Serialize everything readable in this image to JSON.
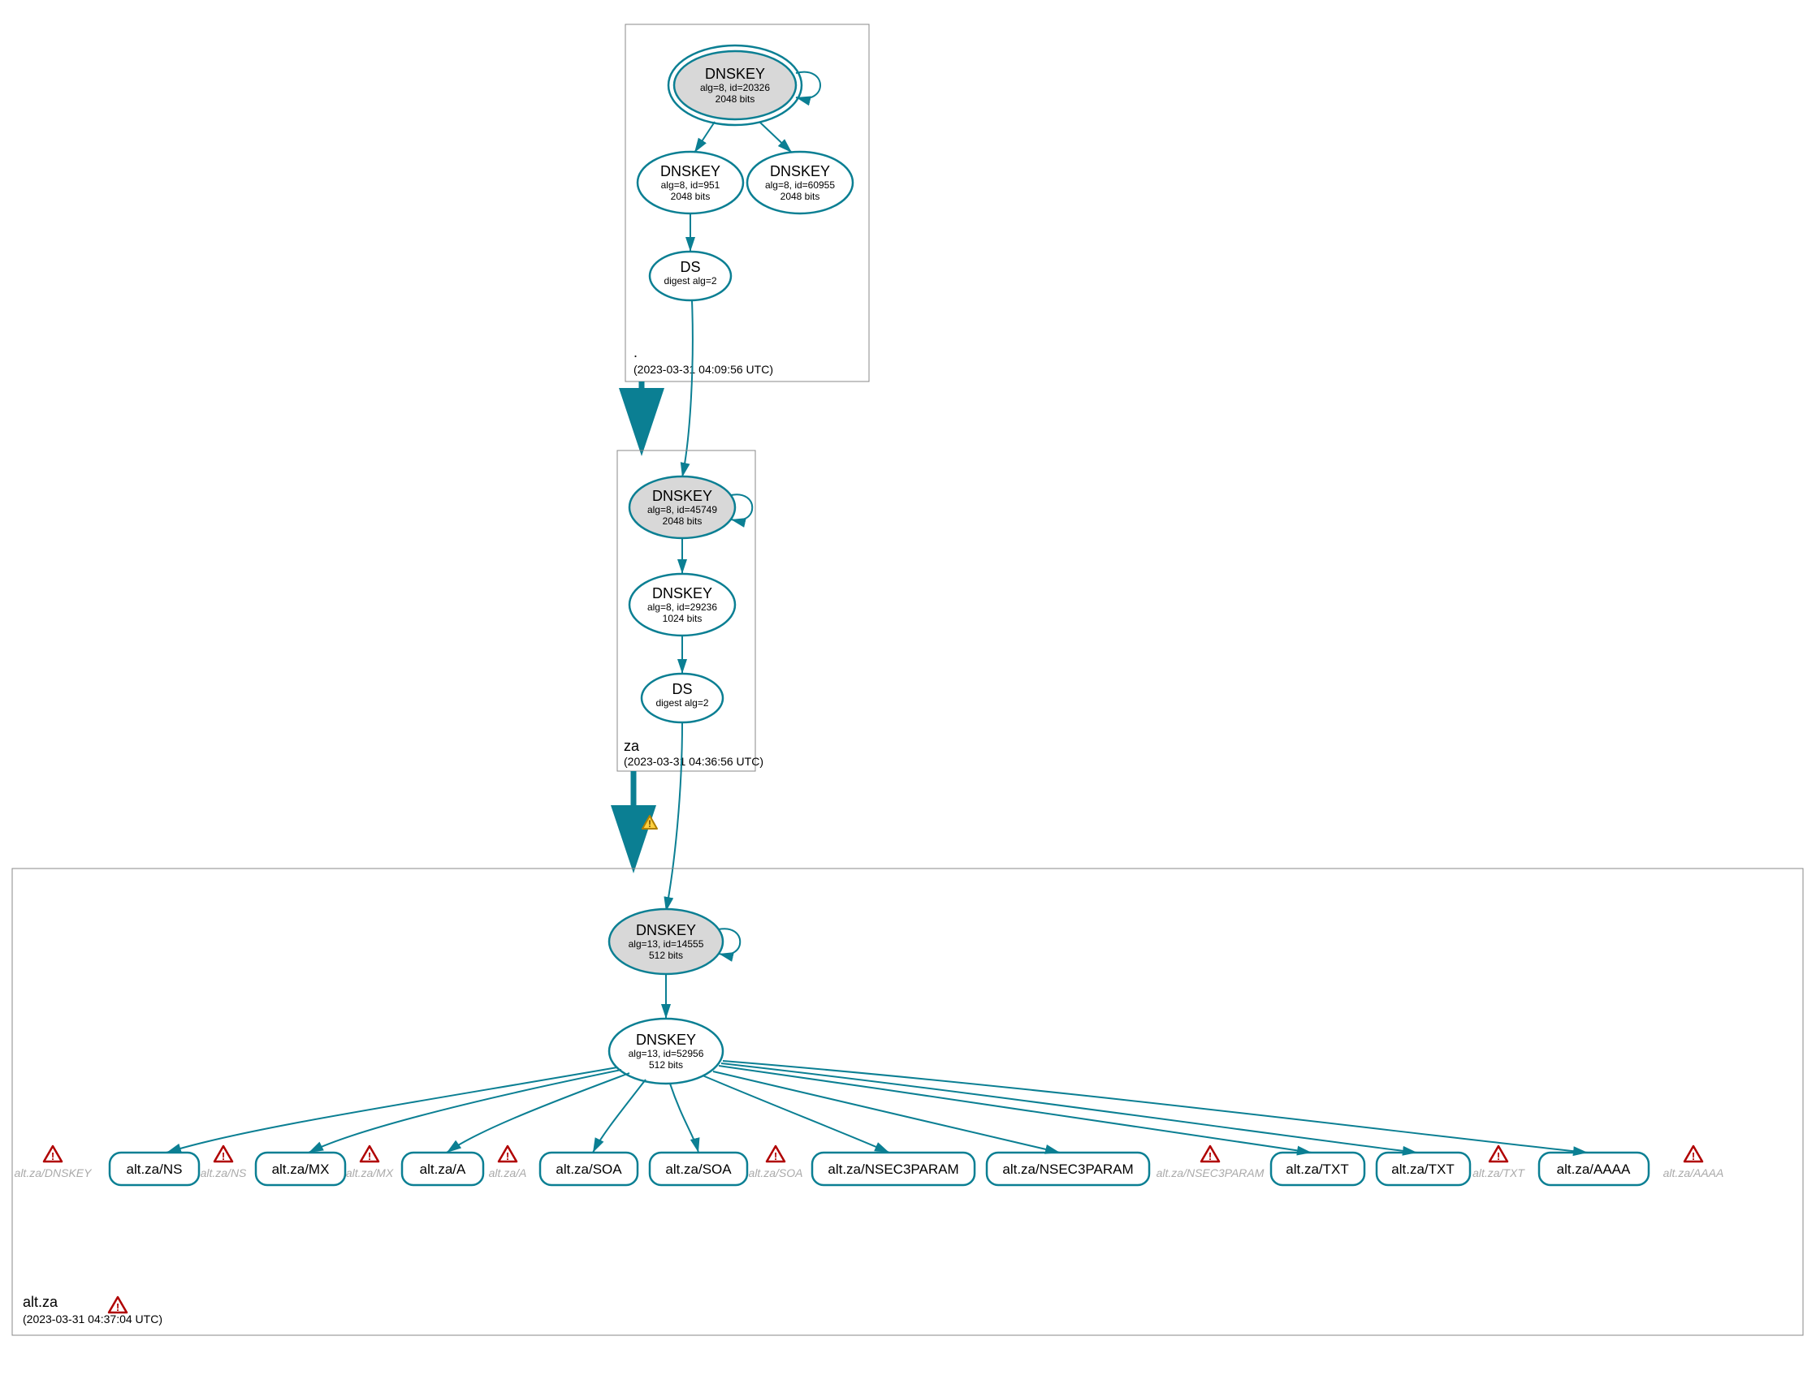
{
  "zones": {
    "root": {
      "label": ".",
      "timestamp": "(2023-03-31 04:09:56 UTC)"
    },
    "za": {
      "label": "za",
      "timestamp": "(2023-03-31 04:36:56 UTC)"
    },
    "alt": {
      "label": "alt.za",
      "timestamp": "(2023-03-31 04:37:04 UTC)"
    }
  },
  "nodes": {
    "root_ksk": {
      "title": "DNSKEY",
      "line1": "alg=8, id=20326",
      "line2": "2048 bits"
    },
    "root_zsk1": {
      "title": "DNSKEY",
      "line1": "alg=8, id=951",
      "line2": "2048 bits"
    },
    "root_zsk2": {
      "title": "DNSKEY",
      "line1": "alg=8, id=60955",
      "line2": "2048 bits"
    },
    "root_ds": {
      "title": "DS",
      "line1": "digest alg=2",
      "line2": ""
    },
    "za_ksk": {
      "title": "DNSKEY",
      "line1": "alg=8, id=45749",
      "line2": "2048 bits"
    },
    "za_zsk": {
      "title": "DNSKEY",
      "line1": "alg=8, id=29236",
      "line2": "1024 bits"
    },
    "za_ds": {
      "title": "DS",
      "line1": "digest alg=2",
      "line2": ""
    },
    "alt_ksk": {
      "title": "DNSKEY",
      "line1": "alg=13, id=14555",
      "line2": "512 bits"
    },
    "alt_zsk": {
      "title": "DNSKEY",
      "line1": "alg=13, id=52956",
      "line2": "512 bits"
    }
  },
  "rrsets": [
    {
      "id": "ns",
      "label": "alt.za/NS"
    },
    {
      "id": "mx",
      "label": "alt.za/MX"
    },
    {
      "id": "a",
      "label": "alt.za/A"
    },
    {
      "id": "soa1",
      "label": "alt.za/SOA"
    },
    {
      "id": "soa2",
      "label": "alt.za/SOA"
    },
    {
      "id": "n3p1",
      "label": "alt.za/NSEC3PARAM"
    },
    {
      "id": "n3p2",
      "label": "alt.za/NSEC3PARAM"
    },
    {
      "id": "txt1",
      "label": "alt.za/TXT"
    },
    {
      "id": "txt2",
      "label": "alt.za/TXT"
    },
    {
      "id": "aaaa",
      "label": "alt.za/AAAA"
    }
  ],
  "grey_labels": {
    "dnskey": "alt.za/DNSKEY",
    "ns": "alt.za/NS",
    "mx": "alt.za/MX",
    "a": "alt.za/A",
    "soa": "alt.za/SOA",
    "n3p": "alt.za/NSEC3PARAM",
    "txt": "alt.za/TXT",
    "aaaa": "alt.za/AAAA"
  }
}
